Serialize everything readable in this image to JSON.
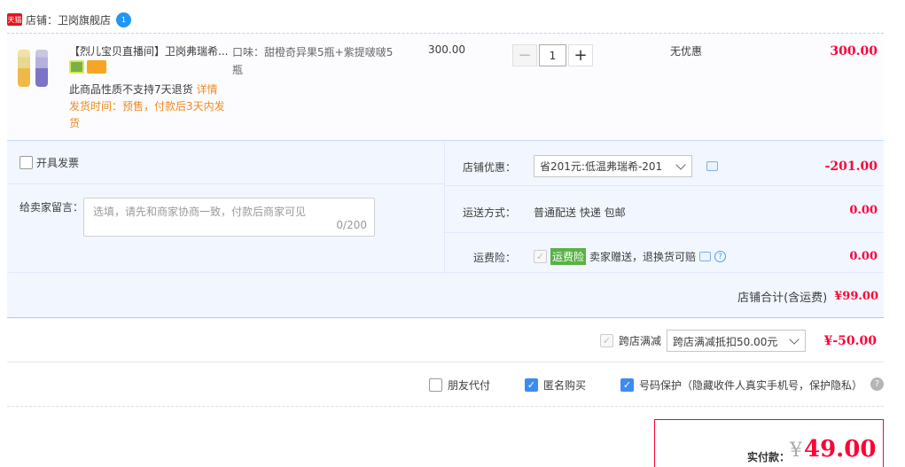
{
  "shop": {
    "badge": "天猫",
    "label": "店铺：",
    "name": "卫岗旗舰店",
    "chat_badge": "1"
  },
  "item": {
    "title": "【烈儿宝贝直播间】卫岗弗瑞希...",
    "refund_note": "此商品性质不支持7天退货",
    "refund_link": "详情",
    "ship_note": "发货时间：预售，付款后3天内发货",
    "sku": "口味：甜橙奇异果5瓶+紫提啵啵5瓶",
    "unit_price": "300.00",
    "quantity": "1",
    "minus": "−",
    "plus": "+",
    "promo": "无优惠",
    "subtotal": "300.00"
  },
  "options": {
    "invoice_label": "开具发票",
    "message_label": "给卖家留言：",
    "message_placeholder": "选填，请先和商家协商一致，付款后商家可见",
    "message_count": "0/200",
    "coupon_label": "店铺优惠：",
    "coupon_value": "省201元:低温弗瑞希-201",
    "coupon_amount": "-201.00",
    "shipping_label": "运送方式：",
    "shipping_value": "普通配送 快递 包邮",
    "shipping_amount": "0.00",
    "insurance_label": "运费险：",
    "insurance_tag": "运费险",
    "insurance_desc": "卖家赠送，退换货可赔",
    "insurance_amount": "0.00",
    "shop_total_label": "店铺合计(含运费)",
    "shop_total_value": "¥99.00"
  },
  "cross_store": {
    "label": "跨店满减",
    "select_value": "跨店满减抵扣50.00元",
    "amount": "¥-50.00"
  },
  "checks": {
    "friend_pay": "朋友代付",
    "anonymous": "匿名购买",
    "number_protect": "号码保护（隐藏收件人真实手机号，保护隐私）"
  },
  "payment": {
    "label": "实付款：",
    "currency": "¥",
    "amount": "49.00"
  },
  "colors": {
    "accent_red": "#ff0036",
    "accent_blue": "#3c8cf0",
    "note_orange": "#f0891f"
  }
}
